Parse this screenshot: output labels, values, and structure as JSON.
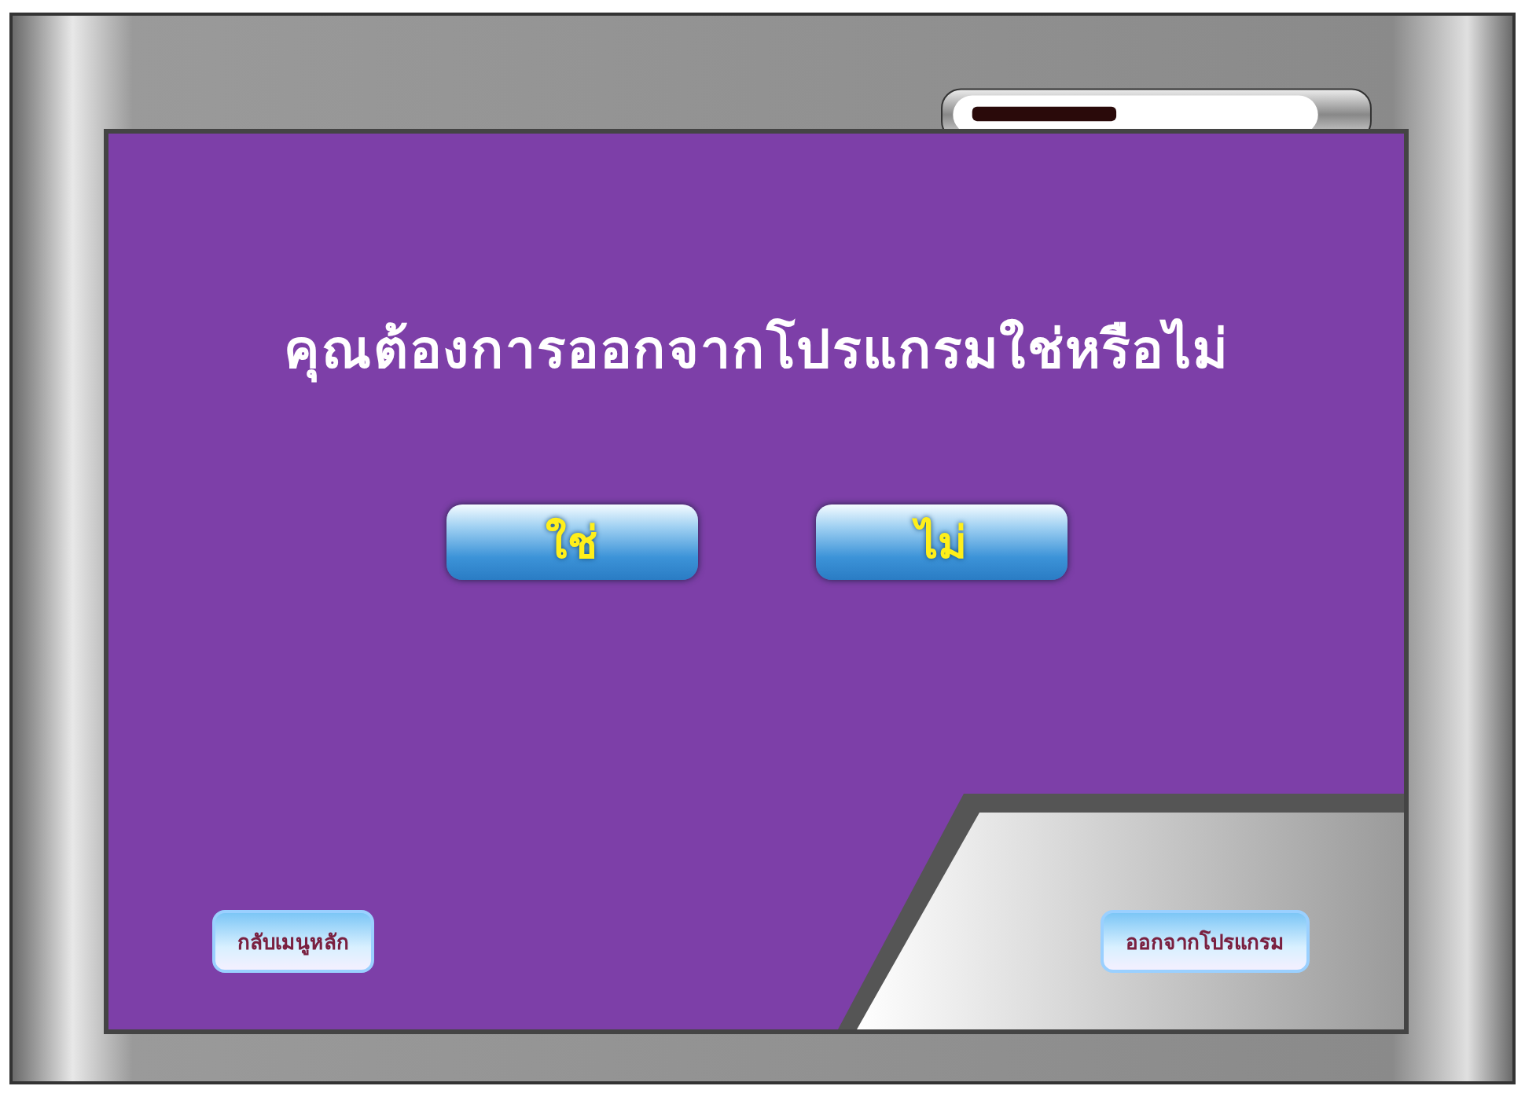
{
  "dialog": {
    "question": "คุณต้องการออกจากโปรแกรมใช่หรือไม่",
    "buttons": [
      {
        "label": "ใช่"
      },
      {
        "label": "ไม่"
      }
    ]
  },
  "footer": {
    "back_button": "กลับเมนูหลัก",
    "exit_button": "ออกจากโปรแกรม"
  }
}
